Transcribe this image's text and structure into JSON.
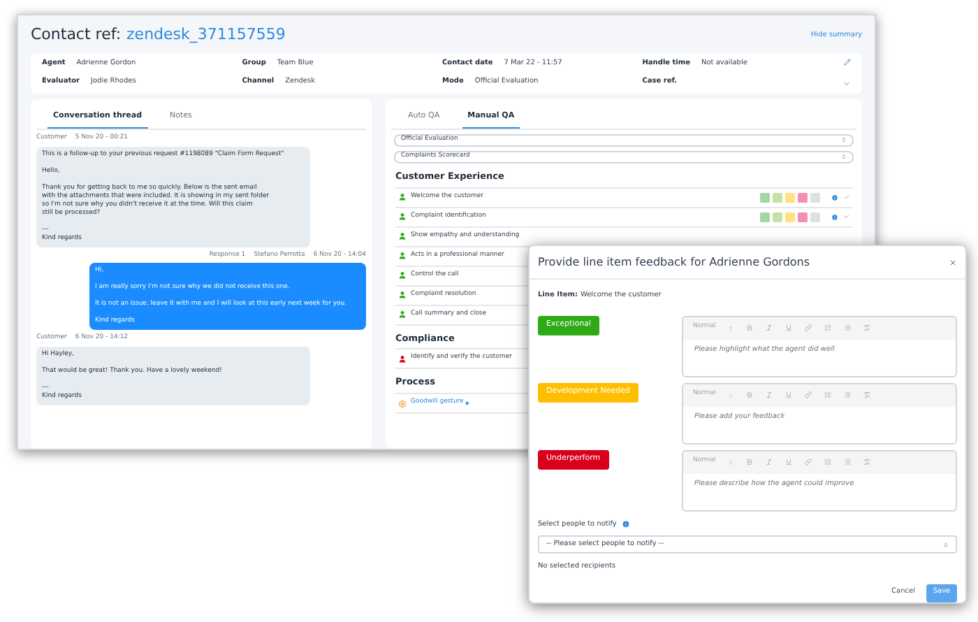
{
  "header": {
    "label": "Contact ref:",
    "ref": "zendesk_371157559",
    "hide_link": "Hide summary"
  },
  "summary": [
    {
      "label": "Agent",
      "value": "Adrienne Gordon"
    },
    {
      "label": "Group",
      "value": "Team Blue"
    },
    {
      "label": "Contact date",
      "value": "7 Mar 22 - 11:57"
    },
    {
      "label": "Handle time",
      "value": "Not available"
    },
    {
      "label": "Evaluator",
      "value": "Jodie Rhodes"
    },
    {
      "label": "Channel",
      "value": "Zendesk"
    },
    {
      "label": "Mode",
      "value": "Official Evaluation"
    },
    {
      "label": "Case ref."
    }
  ],
  "left_tabs": [
    {
      "label": "Conversation thread",
      "selected": true
    },
    {
      "label": "Notes",
      "selected": false
    }
  ],
  "messages": [
    {
      "kind": "customer",
      "meta": [
        "Customer",
        "5 Nov 20 - 00:21"
      ],
      "paragraphs": [
        "This is a follow-up to your previous request #1198089 \"Claim Form Request\"",
        "Hello,",
        "Thank you for getting back to me so quickly. Below is the sent email\nwith the attachments that were included. It is showing in my sent folder\nso I'm not sure why you didn't receive it at the time. Will this claim\nstill be processed?",
        "---\nKind regards"
      ]
    },
    {
      "kind": "agent",
      "meta": [
        "Response 1",
        "Stefano Perrotta",
        "6 Nov 20 - 14:04"
      ],
      "paragraphs": [
        "Hi,",
        "I am really sorry I'm not sure why we did not receive this one.",
        "It is not an issue, leave it with me and I will look at this early next week for you.",
        "Kind regards"
      ]
    },
    {
      "kind": "customer",
      "meta": [
        "Customer",
        "6 Nov 20 - 14:12"
      ],
      "paragraphs": [
        "Hi Hayley,",
        "That would be great! Thank you. Have a lovely weekend!",
        "---\nKind regards"
      ]
    }
  ],
  "right_tabs": [
    {
      "label": "Auto QA",
      "selected": false
    },
    {
      "label": "Manual QA",
      "selected": true
    }
  ],
  "selects": [
    "Official Evaluation",
    "Complaints Scorecard"
  ],
  "sections": [
    {
      "title": "Customer Experience",
      "items": [
        {
          "kind": "pass",
          "label": "Welcome the customer",
          "scale": true
        },
        {
          "kind": "pass",
          "label": "Complaint identification",
          "scale": true
        },
        {
          "kind": "pass",
          "label": "Show empathy and understanding"
        },
        {
          "kind": "pass",
          "label": "Acts in a professional manner"
        },
        {
          "kind": "pass",
          "label": "Control the call"
        },
        {
          "kind": "pass",
          "label": "Complaint resolution"
        },
        {
          "kind": "pass",
          "label": "Call summary and close"
        }
      ]
    },
    {
      "title": "Compliance",
      "items": [
        {
          "kind": "fail",
          "label": "Identify and verify the customer"
        }
      ]
    },
    {
      "title": "Process",
      "items": [
        {
          "kind": "link",
          "label": "Goodwill gesture"
        }
      ]
    }
  ],
  "modal": {
    "title": "Provide line item feedback for Adrienne Gordons",
    "line_label": "Line Item:",
    "line_value": "Welcome the customer",
    "feedback": [
      {
        "label": "Exceptional",
        "color": "#2eaa16",
        "format": "Normal",
        "placeholder": "Please highlight what the agent did well"
      },
      {
        "label": "Development Needed",
        "color": "#ffbf00",
        "format": "Normal",
        "placeholder": "Please add your feedback"
      },
      {
        "label": "Underperform",
        "color": "#d9001b",
        "format": "Normal",
        "placeholder": "Please describe how the agent could improve"
      }
    ],
    "notify_label": "Select people to notify",
    "notify_placeholder": "-- Please select people to notify --",
    "recipients": "No selected recipients",
    "cancel": "Cancel",
    "save": "Save"
  }
}
